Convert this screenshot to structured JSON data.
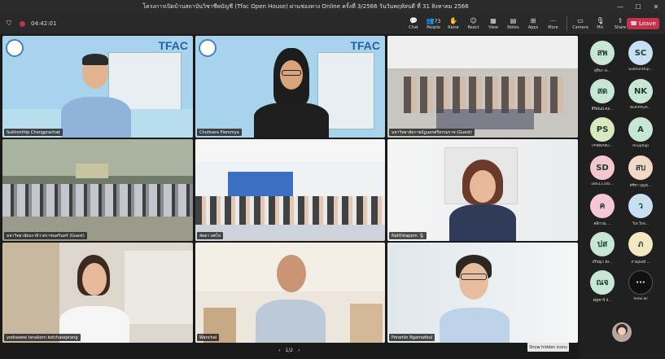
{
  "window": {
    "title": "โครงการเปิดบ้านสถาบันวิชาชีพบัญชี (Tfac Open House) ผ่านช่องทาง Online ครั้งที่ 3/2566 วันวันพฤหัสบดี ที่ 31 สิงหาคม 2566"
  },
  "meeting": {
    "timer": "04:42:01",
    "leave_label": "Leave",
    "page_indicator": "1/2",
    "hidden_icons_tip": "Show hidden icons"
  },
  "toolbar": [
    {
      "icon": "chat-icon",
      "label": "Chat",
      "badge": ""
    },
    {
      "icon": "people-icon",
      "label": "People",
      "badge": "73"
    },
    {
      "icon": "raise-hand-icon",
      "label": "Raise",
      "badge": ""
    },
    {
      "icon": "react-icon",
      "label": "React",
      "badge": ""
    },
    {
      "icon": "view-icon",
      "label": "View",
      "badge": ""
    },
    {
      "icon": "notes-icon",
      "label": "Notes",
      "badge": ""
    },
    {
      "icon": "apps-icon",
      "label": "Apps",
      "badge": ""
    },
    {
      "icon": "more-icon",
      "label": "More",
      "badge": ""
    },
    {
      "icon": "camera-icon",
      "label": "Camera",
      "badge": ""
    },
    {
      "icon": "mic-icon",
      "label": "Mic",
      "badge": ""
    },
    {
      "icon": "share-icon",
      "label": "Share",
      "badge": ""
    }
  ],
  "tiles": [
    {
      "name": "Sukhonthip Chengprachak",
      "brand": "TFAC"
    },
    {
      "name": "Chutisara Piemmya",
      "brand": "TFAC"
    },
    {
      "name": "มหาวิทยาลัยราชภัฏนครศรีธรรมราช (Guest)",
      "brand": ""
    },
    {
      "name": "มหาวิทยาลัยนราธิวาสราชนครินทร์ (Guest)",
      "brand": ""
    },
    {
      "name": "ลัดดา ยศโห",
      "brand": ""
    },
    {
      "name": "Natthitaporn",
      "brand": ""
    },
    {
      "name": "yodsawee tanakorn kotchaseprang",
      "brand": ""
    },
    {
      "name": "Wanchai",
      "brand": ""
    },
    {
      "name": "Poramin Ngamwibul",
      "brand": ""
    }
  ],
  "attendees": [
    {
      "initials": "สพ",
      "name": "สุทินา พ...",
      "color": "#c7e6d6"
    },
    {
      "initials": "SC",
      "name": "Sukhonthip...",
      "color": "#c7e0f4"
    },
    {
      "initials": "สด",
      "name": "สิริพัณน์ ดอ...",
      "color": "#c7e6d6"
    },
    {
      "initials": "NK",
      "name": "NOPPADA...",
      "color": "#c7e6d6"
    },
    {
      "initials": "PS",
      "name": "PANNAKO...",
      "color": "#d8e8c0"
    },
    {
      "initials": "A",
      "name": "Anuphap",
      "color": "#c7e6d6"
    },
    {
      "initials": "SD",
      "name": "u6611100...",
      "color": "#f4c7cf"
    },
    {
      "initials": "สบ",
      "name": "ศรีทา บุญข...",
      "color": "#f4d8c7"
    },
    {
      "initials": "ค",
      "name": "คลิกาณ ...",
      "color": "#f4c7d8"
    },
    {
      "initials": "ว",
      "name": "วีเจ ใกล...",
      "color": "#c7e0f4"
    },
    {
      "initials": "ปส",
      "name": "ปริชญา สัง...",
      "color": "#c7e6d6"
    },
    {
      "initials": "ภ",
      "name": "ภาณุพงษ์ ...",
      "color": "#f4e8c0"
    },
    {
      "initials": "ณจ",
      "name": "ณัฐชาร์ จั...",
      "color": "#c7e6d6"
    },
    {
      "initials": "···",
      "name": "View all",
      "color": "#111111"
    }
  ]
}
